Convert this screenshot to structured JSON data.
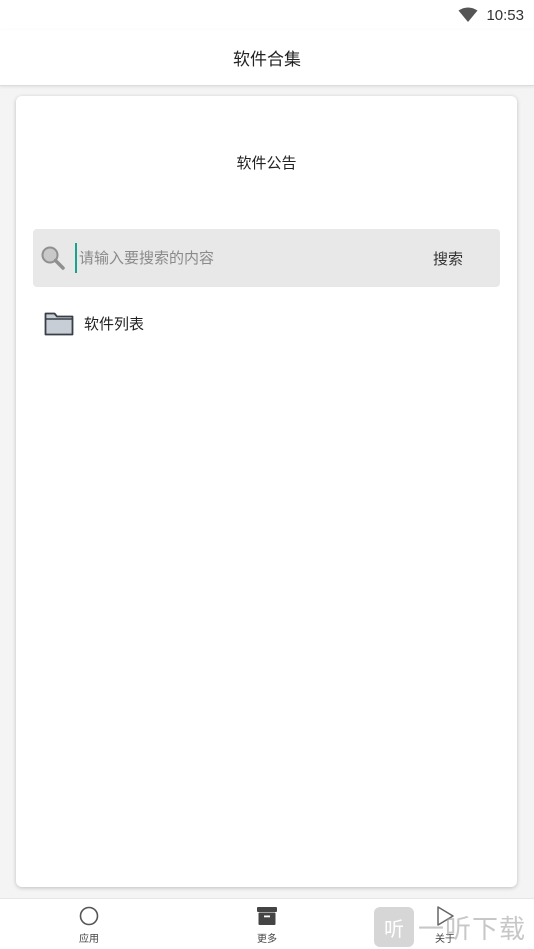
{
  "status_bar": {
    "time": "10:53"
  },
  "header": {
    "title": "软件合集"
  },
  "card": {
    "announcement": "软件公告",
    "search": {
      "placeholder": "请输入要搜索的内容",
      "value": "",
      "button_label": "搜索"
    },
    "items": [
      {
        "label": "软件列表"
      }
    ]
  },
  "bottom_nav": {
    "items": [
      {
        "label": "应用",
        "icon": "circle-icon"
      },
      {
        "label": "更多",
        "icon": "archive-icon"
      },
      {
        "label": "关于",
        "icon": "play-icon"
      }
    ]
  },
  "watermark": {
    "logo": "听",
    "text": "一听下载"
  },
  "colors": {
    "accent": "#1aa38a",
    "search_bg": "#e8e8e8",
    "background": "#f4f4f4"
  }
}
